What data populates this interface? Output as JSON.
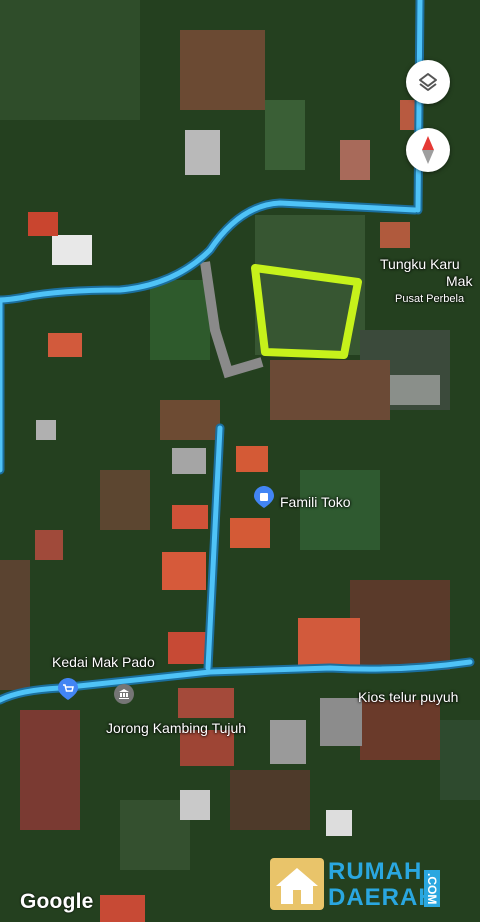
{
  "places": {
    "tungku": "Tungku Karu",
    "tungku_cont": "Mak",
    "pusat": "Pusat Perbela",
    "famili": "Famili Toko",
    "kedai": "Kedai Mak Pado",
    "kios": "Kios telur puyuh",
    "jorong": "Jorong Kambing Tujuh"
  },
  "controls": {
    "layers": "layers-icon",
    "compass": "compass-icon"
  },
  "attribution": "Google",
  "watermark": {
    "line1": "RUMAH",
    "line2": "DAERAH",
    "suffix": ".COM"
  },
  "colors": {
    "road": "#4fc3f7",
    "highlight": "#c6f21b",
    "watermark": "#2aa7e0"
  }
}
